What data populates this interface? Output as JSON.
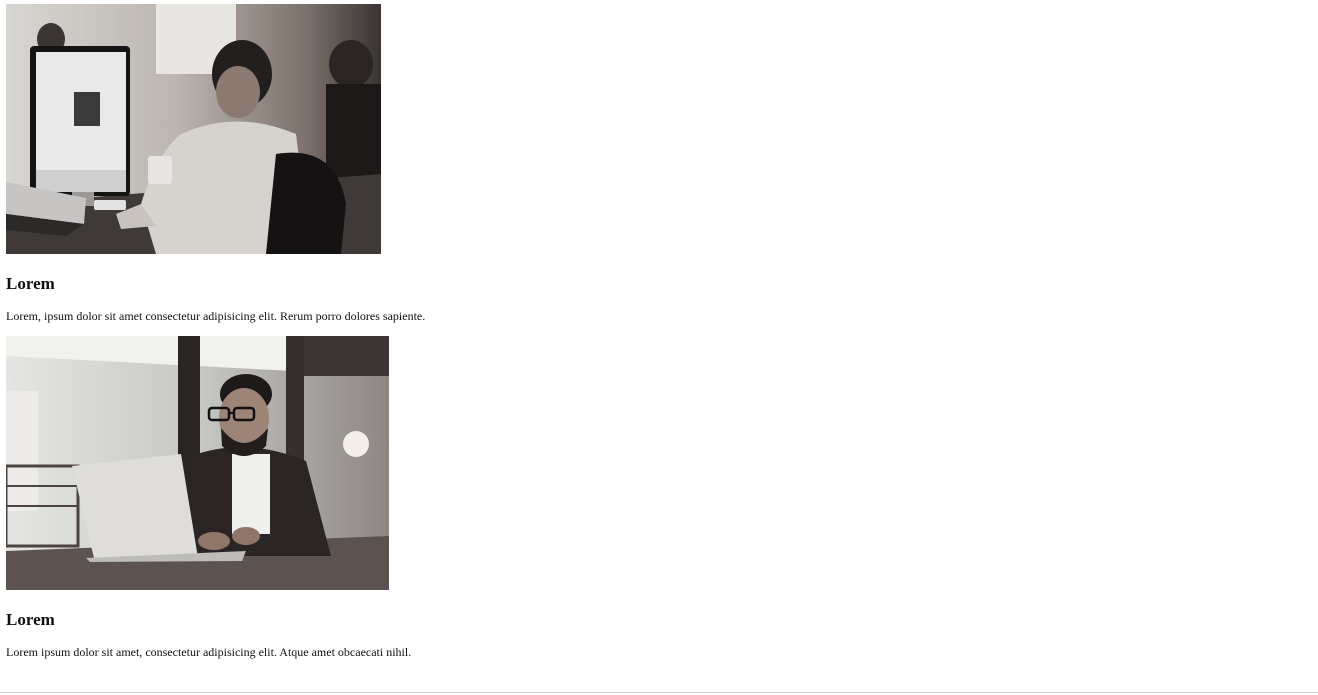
{
  "cards": [
    {
      "image_alt": "Man working at a desktop computer in an office",
      "title": "Lorem",
      "text": "Lorem, ipsum dolor sit amet consectetur adipisicing elit. Rerum porro dolores sapiente."
    },
    {
      "image_alt": "Smiling man with glasses working on a laptop",
      "title": "Lorem",
      "text": "Lorem ipsum dolor sit amet, consectetur adipisicing elit. Atque amet obcaecati nihil."
    }
  ]
}
